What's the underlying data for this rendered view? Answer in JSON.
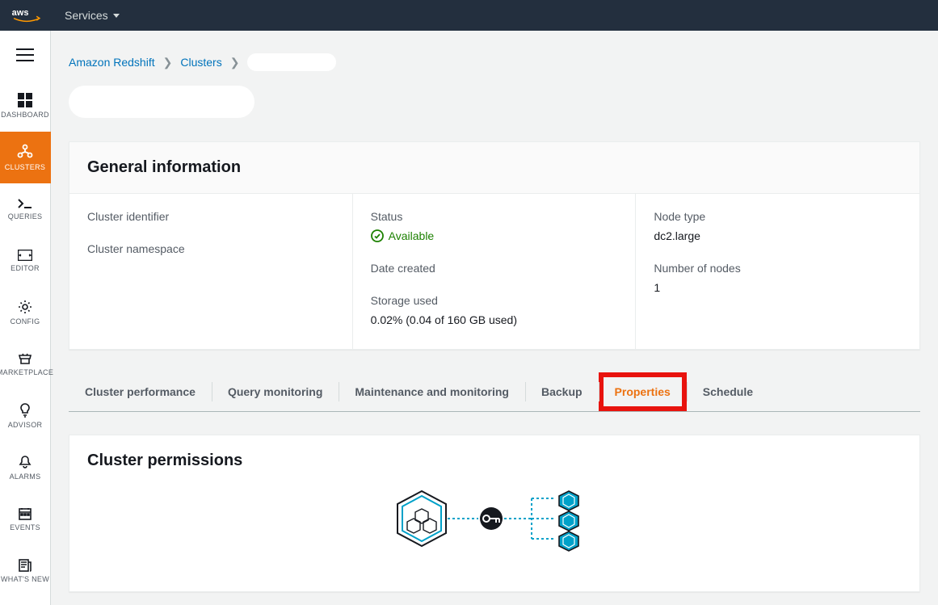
{
  "topbar": {
    "services_label": "Services"
  },
  "breadcrumb": {
    "root": "Amazon Redshift",
    "parent": "Clusters"
  },
  "sidenav": {
    "items": [
      {
        "label": "DASHBOARD"
      },
      {
        "label": "CLUSTERS"
      },
      {
        "label": "QUERIES"
      },
      {
        "label": "EDITOR"
      },
      {
        "label": "CONFIG"
      },
      {
        "label": "MARKETPLACE"
      },
      {
        "label": "ADVISOR"
      },
      {
        "label": "ALARMS"
      },
      {
        "label": "EVENTS"
      },
      {
        "label": "WHAT'S NEW"
      }
    ]
  },
  "general": {
    "heading": "General information",
    "cluster_identifier_label": "Cluster identifier",
    "cluster_namespace_label": "Cluster namespace",
    "status_label": "Status",
    "status_value": "Available",
    "date_created_label": "Date created",
    "storage_used_label": "Storage used",
    "storage_used_value": "0.02% (0.04 of 160 GB used)",
    "node_type_label": "Node type",
    "node_type_value": "dc2.large",
    "num_nodes_label": "Number of nodes",
    "num_nodes_value": "1"
  },
  "tabs": {
    "items": [
      {
        "label": "Cluster performance"
      },
      {
        "label": "Query monitoring"
      },
      {
        "label": "Maintenance and monitoring"
      },
      {
        "label": "Backup"
      },
      {
        "label": "Properties"
      },
      {
        "label": "Schedule"
      }
    ],
    "active_index": 4
  },
  "permissions": {
    "heading": "Cluster permissions"
  }
}
